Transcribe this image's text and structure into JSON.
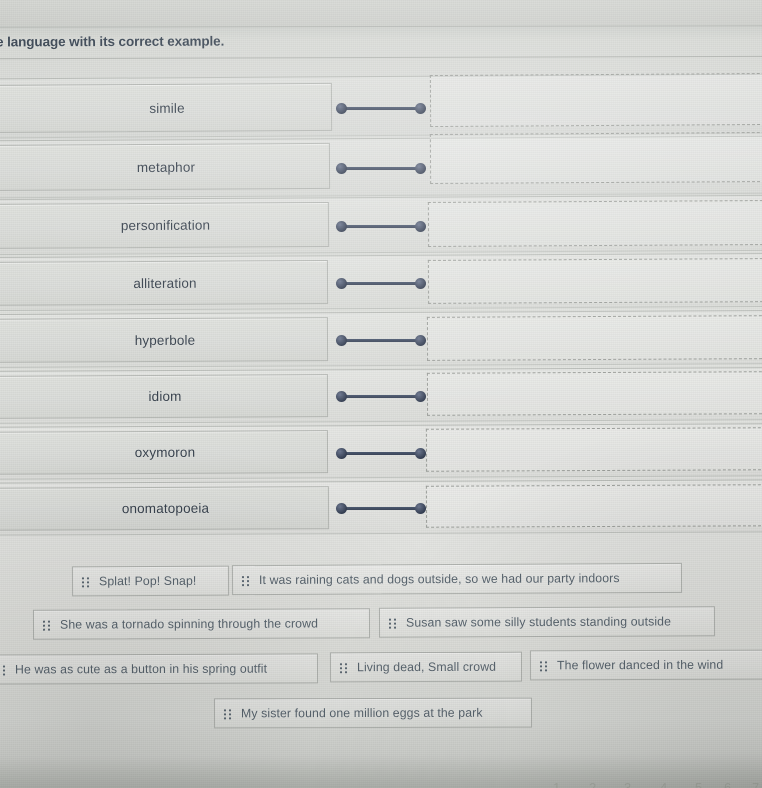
{
  "activity": {
    "type": "matching-drag-and-drop",
    "prompt": "e language with its correct example."
  },
  "left_column": {
    "label": "figurative-language-terms",
    "items": [
      {
        "label": "simile"
      },
      {
        "label": "metaphor"
      },
      {
        "label": "personification"
      },
      {
        "label": "alliteration"
      },
      {
        "label": "hyperbole"
      },
      {
        "label": "idiom"
      },
      {
        "label": "oxymoron"
      },
      {
        "label": "onomatopoeia"
      }
    ]
  },
  "right_column": {
    "label": "answer-drop-zones",
    "count": 8,
    "items": [
      {
        "value": ""
      },
      {
        "value": ""
      },
      {
        "value": ""
      },
      {
        "value": ""
      },
      {
        "value": ""
      },
      {
        "value": ""
      },
      {
        "value": ""
      },
      {
        "value": ""
      }
    ]
  },
  "answer_bank": {
    "grip_icon": "drag-handle-icon",
    "rows": [
      [
        {
          "text": "Splat! Pop! Snap!"
        },
        {
          "text": "It was raining cats and dogs outside, so we had our party indoors"
        }
      ],
      [
        {
          "text": "She was a tornado spinning through the crowd"
        },
        {
          "text": "Susan saw some silly students standing outside"
        }
      ],
      [
        {
          "text": "He was as cute as a button in his spring outfit"
        },
        {
          "text": "Living dead, Small crowd"
        },
        {
          "text": "The flower danced in the wind"
        }
      ],
      [
        {
          "text": "My sister found one million eggs at the park"
        }
      ]
    ]
  },
  "pagination": {
    "pages": [
      "1",
      "2",
      "3",
      "4",
      "5",
      "6",
      "7"
    ]
  },
  "colors": {
    "connector": "#3b4559",
    "term_text": "#39434f",
    "chip_text": "#59656f",
    "heading_text": "#3e4a57",
    "surface": "#dfe1dd",
    "border": "#b6b9b5",
    "dashed_border": "#9ea19d"
  }
}
